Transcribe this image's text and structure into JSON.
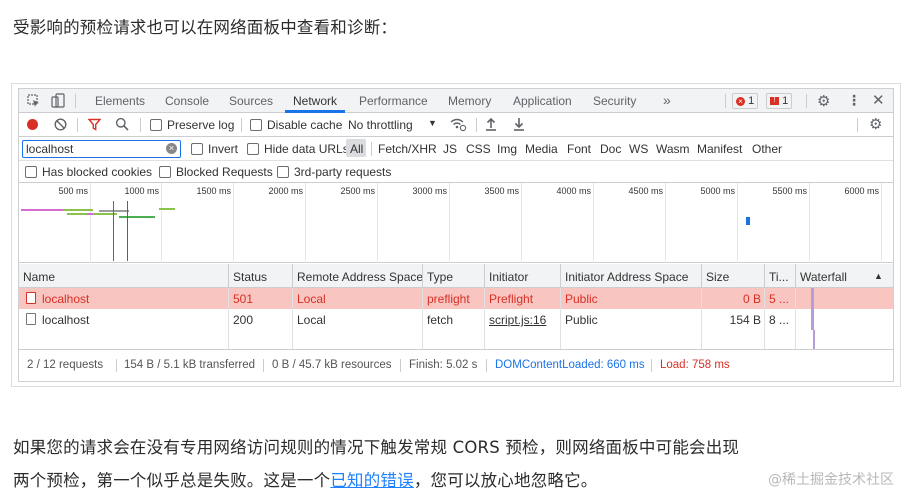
{
  "article": {
    "intro": "受影响的预检请求也可以在网络面板中查看和诊断：",
    "line1": "如果您的请求会在没有专用网络访问规则的情况下触发常规 CORS 预检，则网络面板中可能会出现",
    "line2_before": "两个预检，第一个似乎总是失败。这是一个",
    "line2_link": "已知的错误",
    "line2_after": "，您可以放心地忽略它。",
    "watermark": "@稀土掘金技术社区"
  },
  "devtools": {
    "tabs": [
      "Elements",
      "Console",
      "Sources",
      "Network",
      "Performance",
      "Memory",
      "Application",
      "Security"
    ],
    "tabs_more": "»",
    "selected_tab": "Network",
    "error_count": "1",
    "issue_count": "1",
    "toolbar": {
      "preserve_log": "Preserve log",
      "disable_cache": "Disable cache",
      "throttling": "No throttling"
    },
    "filter": {
      "value": "localhost",
      "invert": "Invert",
      "hide_data_urls": "Hide data URLs",
      "types": [
        "All",
        "Fetch/XHR",
        "JS",
        "CSS",
        "Img",
        "Media",
        "Font",
        "Doc",
        "WS",
        "Wasm",
        "Manifest",
        "Other"
      ]
    },
    "checkboxes": {
      "blocked_cookies": "Has blocked cookies",
      "blocked_requests": "Blocked Requests",
      "third_party": "3rd-party requests"
    },
    "overview_ticks": [
      "500 ms",
      "1000 ms",
      "1500 ms",
      "2000 ms",
      "2500 ms",
      "3000 ms",
      "3500 ms",
      "4000 ms",
      "4500 ms",
      "5000 ms",
      "5500 ms",
      "6000 ms"
    ],
    "columns": [
      "Name",
      "Status",
      "Remote Address Space",
      "Type",
      "Initiator",
      "Initiator Address Space",
      "Size",
      "Ti...",
      "Waterfall"
    ],
    "rows": [
      {
        "name": "localhost",
        "status": "501",
        "remote": "Local",
        "type": "preflight",
        "initiator": "Preflight",
        "init_space": "Public",
        "size": "0 B",
        "time": "5 ..."
      },
      {
        "name": "localhost",
        "status": "200",
        "remote": "Local",
        "type": "fetch",
        "initiator": "script.js:16",
        "init_space": "Public",
        "size": "154 B",
        "time": "8 ..."
      }
    ],
    "status": {
      "requests": "2 / 12 requests",
      "transferred": "154 B / 5.1 kB transferred",
      "resources": "0 B / 45.7 kB resources",
      "finish": "Finish: 5.02 s",
      "dcl": "DOMContentLoaded: 660 ms",
      "load": "Load: 758 ms"
    },
    "colors": {
      "accent": "#1a73e8",
      "error": "#d93025",
      "error_row": "#f8c5c1",
      "dcl": "#1a73e8",
      "load": "#d93025"
    }
  }
}
